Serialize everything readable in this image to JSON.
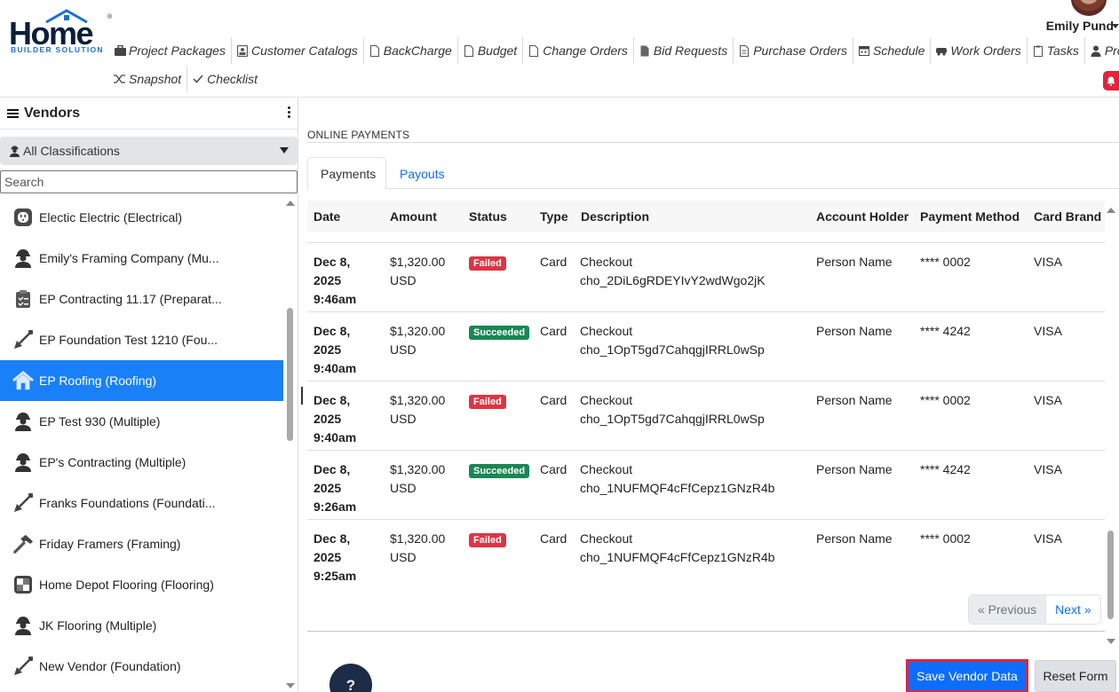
{
  "brand": {
    "word": "Home",
    "sub": "BUILDER SOLUTION",
    "reg": "®"
  },
  "user": {
    "name": "Emily Pund"
  },
  "nav": {
    "row1": [
      {
        "label": "Project Packages",
        "icon": "briefcase-icon"
      },
      {
        "label": "Customer Catalogs",
        "icon": "id-badge-icon"
      },
      {
        "label": "BackCharge",
        "icon": "file-icon"
      },
      {
        "label": "Budget",
        "icon": "file-icon"
      },
      {
        "label": "Change Orders",
        "icon": "file-icon"
      },
      {
        "label": "Bid Requests",
        "icon": "file-text-icon"
      },
      {
        "label": "Purchase Orders",
        "icon": "file-text-icon"
      },
      {
        "label": "Schedule",
        "icon": "calendar-icon"
      },
      {
        "label": "Work Orders",
        "icon": "truck-icon"
      },
      {
        "label": "Tasks",
        "icon": "clipboard-icon"
      },
      {
        "label": "Project",
        "icon": "user-tie-icon"
      }
    ],
    "row2": [
      {
        "label": "Snapshot",
        "icon": "shuffle-icon"
      },
      {
        "label": "Checklist",
        "icon": "check-icon"
      }
    ]
  },
  "sidebar": {
    "title": "Vendors",
    "classification": "All Classifications",
    "search_placeholder": "Search",
    "vendors": [
      {
        "label": "Electic Electric (Electrical)",
        "icon": "outlet-icon"
      },
      {
        "label": "Emily's Framing Company (Mu...",
        "icon": "worker-icon"
      },
      {
        "label": "EP Contracting 11.17 (Preparat...",
        "icon": "clipboard-check-icon"
      },
      {
        "label": "EP Foundation Test 1210 (Fou...",
        "icon": "shovel-icon"
      },
      {
        "label": "EP Roofing (Roofing)",
        "icon": "house-icon",
        "active": true
      },
      {
        "label": "EP Test 930 (Multiple)",
        "icon": "worker-icon"
      },
      {
        "label": "EP's Contracting (Multiple)",
        "icon": "worker-icon"
      },
      {
        "label": "Franks Foundations (Foundati...",
        "icon": "shovel-icon"
      },
      {
        "label": "Friday Framers (Framing)",
        "icon": "hammer-icon"
      },
      {
        "label": "Home Depot Flooring (Flooring)",
        "icon": "floor-tile-icon"
      },
      {
        "label": "JK Flooring (Multiple)",
        "icon": "worker-icon"
      },
      {
        "label": "New Vendor (Foundation)",
        "icon": "shovel-icon"
      }
    ]
  },
  "main": {
    "section_title": "ONLINE PAYMENTS",
    "tabs": [
      "Payments",
      "Payouts"
    ],
    "columns": [
      "Date",
      "Amount",
      "Status",
      "Type",
      "Description",
      "Account Holder",
      "Payment Method",
      "Card Brand"
    ],
    "rows": [
      {
        "date": [
          "Dec 8,",
          "2025",
          "9:46am"
        ],
        "amount": [
          "$1,320.00",
          "USD"
        ],
        "status": "Failed",
        "type": "Card",
        "description": [
          "Checkout",
          "cho_2DiL6gRDEYIvY2wdWgo2jK"
        ],
        "holder": "Person Name",
        "method": "**** 0002",
        "brand": "VISA"
      },
      {
        "date": [
          "Dec 8,",
          "2025",
          "9:40am"
        ],
        "amount": [
          "$1,320.00",
          "USD"
        ],
        "status": "Succeeded",
        "type": "Card",
        "description": [
          "Checkout",
          "cho_1OpT5gd7CahqgjIRRL0wSp"
        ],
        "holder": "Person Name",
        "method": "**** 4242",
        "brand": "VISA"
      },
      {
        "date": [
          "Dec 8,",
          "2025",
          "9:40am"
        ],
        "amount": [
          "$1,320.00",
          "USD"
        ],
        "status": "Failed",
        "type": "Card",
        "description": [
          "Checkout",
          "cho_1OpT5gd7CahqgjIRRL0wSp"
        ],
        "holder": "Person Name",
        "method": "**** 0002",
        "brand": "VISA"
      },
      {
        "date": [
          "Dec 8,",
          "2025",
          "9:26am"
        ],
        "amount": [
          "$1,320.00",
          "USD"
        ],
        "status": "Succeeded",
        "type": "Card",
        "description": [
          "Checkout",
          "cho_1NUFMQF4cFfCepz1GNzR4b"
        ],
        "holder": "Person Name",
        "method": "**** 4242",
        "brand": "VISA"
      },
      {
        "date": [
          "Dec 8,",
          "2025",
          "9:25am"
        ],
        "amount": [
          "$1,320.00",
          "USD"
        ],
        "status": "Failed",
        "type": "Card",
        "description": [
          "Checkout",
          "cho_1NUFMQF4cFfCepz1GNzR4b"
        ],
        "holder": "Person Name",
        "method": "**** 0002",
        "brand": "VISA"
      }
    ],
    "pager": {
      "prev": "« Previous",
      "next": "Next »"
    },
    "help": "?",
    "save_label": "Save Vendor Data",
    "reset_label": "Reset Form"
  },
  "colors": {
    "accent": "#0d6efd",
    "active_row": "#1a80f7",
    "failed": "#dc3545",
    "succeeded": "#198754",
    "save_outline": "#e0243c"
  }
}
